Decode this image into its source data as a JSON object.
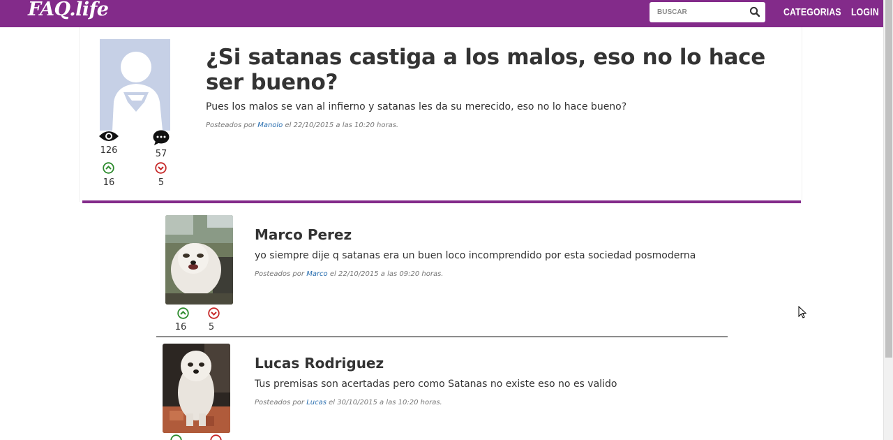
{
  "header": {
    "logo": "FAQ.life",
    "search_placeholder": "BUSCAR",
    "nav": {
      "categories": "CATEGORIAS",
      "login": "LOGIN"
    }
  },
  "question": {
    "title": "¿Si satanas castiga a los malos, eso no lo hace ser bueno?",
    "body": "Pues los malos se van al infierno y satanas les da su merecido, eso no lo hace bueno?",
    "meta": {
      "prefix": "Posteados por",
      "author": "Manolo",
      "date": "el 22/10/2015 a las 10:20 horas."
    },
    "stats": {
      "views": "126",
      "comments": "57",
      "upvotes": "16",
      "downvotes": "5"
    }
  },
  "answers": [
    {
      "name": "Marco Perez",
      "text": "yo siempre dije q satanas era un buen loco incomprendido por esta sociedad posmoderna",
      "meta": {
        "prefix": "Posteados por",
        "author": "Marco",
        "date": "el 22/10/2015 a las 09:20 horas."
      },
      "upvotes": "16",
      "downvotes": "5"
    },
    {
      "name": "Lucas Rodriguez",
      "text": "Tus premisas son acertadas pero como Satanas no existe eso no es valido",
      "meta": {
        "prefix": "Posteados por",
        "author": "Lucas",
        "date": "el 30/10/2015 a las 10:20 horas."
      }
    }
  ],
  "icons": {
    "views": "eye-icon",
    "comments": "speech-bubble-icon",
    "upvote": "chevron-up-circle-icon",
    "downvote": "chevron-down-circle-icon",
    "search": "search-icon"
  },
  "colors": {
    "brand": "#832b8a",
    "upvote": "#2e8b2e",
    "downvote": "#c62828",
    "link": "#2a6fb0"
  }
}
